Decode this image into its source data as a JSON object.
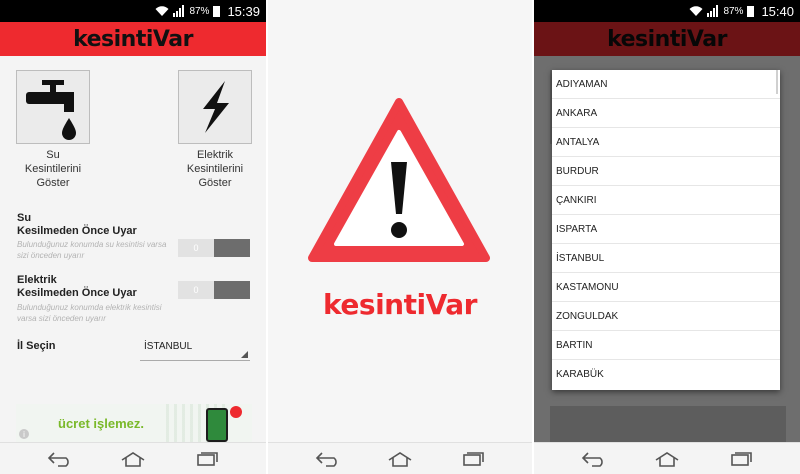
{
  "status": {
    "battery_pct": "87%",
    "time_left": "15:39",
    "time_right": "15:40"
  },
  "app": {
    "title": "kesintiVar"
  },
  "main": {
    "water_button": {
      "label": "Su\nKesintilerini\nGöster",
      "icon": "faucet-drop-icon"
    },
    "electric_button": {
      "label": "Elektrik\nKesintilerini\nGöster",
      "icon": "lightning-bolt-icon"
    },
    "water_warn": {
      "title": "Su\nKesilmeden Önce Uyar",
      "desc": "Bulunduğunuz konumda su kesintisi varsa sizi önceden uyarır",
      "toggle_value": "0"
    },
    "electric_warn": {
      "title": "Elektrik\nKesilmeden Önce Uyar",
      "desc": "Bulunduğunuz konumda elektrik kesintisi varsa sizi önceden uyarır",
      "toggle_value": "0"
    },
    "city": {
      "label": "İl Seçin",
      "selected": "İSTANBUL"
    },
    "ad": {
      "text": "ücret işlemez.",
      "info": "i"
    }
  },
  "splash": {
    "title": "kesintiVar",
    "icon": "warning-triangle-icon"
  },
  "city_picker": {
    "options": [
      "ADIYAMAN",
      "ANKARA",
      "ANTALYA",
      "BURDUR",
      "ÇANKIRI",
      "ISPARTA",
      "İSTANBUL",
      "KASTAMONU",
      "ZONGULDAK",
      "BARTIN",
      "KARABÜK"
    ]
  },
  "colors": {
    "brand_red": "#ee2a2f",
    "toggle_knob": "#6d6d6d"
  }
}
